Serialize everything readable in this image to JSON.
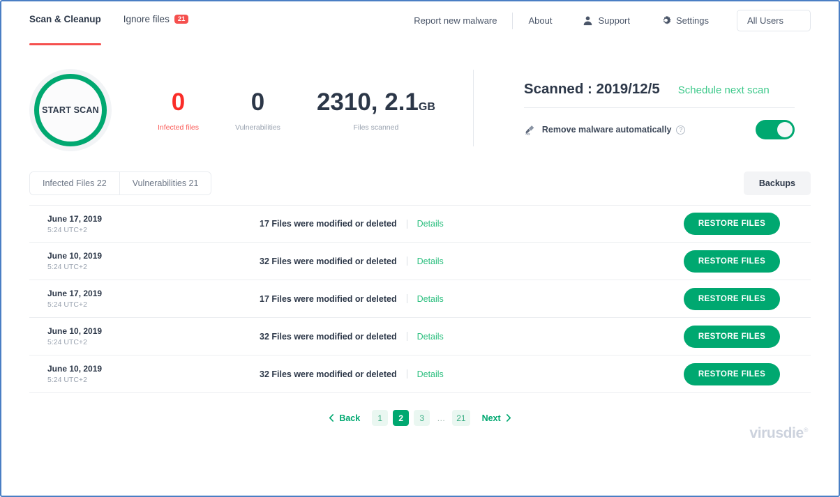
{
  "header": {
    "tabs": [
      {
        "label": "Scan & Cleanup",
        "active": true,
        "badge": null
      },
      {
        "label": "Ignore files",
        "active": false,
        "badge": "21"
      }
    ],
    "right_items": [
      {
        "label": "Report new malware",
        "icon": null
      },
      {
        "label": "About",
        "icon": null
      },
      {
        "label": "Support",
        "icon": "user-icon"
      },
      {
        "label": "Settings",
        "icon": "gear-icon"
      }
    ],
    "user_select": "All Users"
  },
  "scan": {
    "start_button": "START SCAN",
    "stats": [
      {
        "value": "0",
        "unit": "",
        "label": "Infected files",
        "color": "#fa2d28"
      },
      {
        "value": "0",
        "unit": "",
        "label": "Vulnerabilities",
        "color": "#2c3748"
      },
      {
        "value": "2310, 2.1",
        "unit": "GB",
        "label": "Files scanned",
        "color": "#2c3748"
      }
    ],
    "scanned_title": "Scanned : 2019/12/5",
    "schedule_link": "Schedule next scan",
    "remove_label": "Remove malware automatically",
    "help_glyph": "?",
    "toggle_on": true,
    "accent_green": "#00a870"
  },
  "tabbar": {
    "pills": [
      {
        "label": "Infected Files 22"
      },
      {
        "label": "Vulnerabilities 21"
      }
    ],
    "backups": "Backups"
  },
  "table": {
    "rows": [
      {
        "date": "June 17, 2019",
        "time": "5:24 UTC+2",
        "files": "17 Files were modified or deleted",
        "details": "Details",
        "action": "RESTORE FILES"
      },
      {
        "date": "June 10, 2019",
        "time": "5:24 UTC+2",
        "files": "32 Files were modified or deleted",
        "details": "Details",
        "action": "RESTORE FILES"
      },
      {
        "date": "June 17, 2019",
        "time": "5:24 UTC+2",
        "files": "17 Files were modified or deleted",
        "details": "Details",
        "action": "RESTORE FILES"
      },
      {
        "date": "June 10, 2019",
        "time": "5:24 UTC+2",
        "files": "32 Files were modified or deleted",
        "details": "Details",
        "action": "RESTORE FILES"
      },
      {
        "date": "June 10, 2019",
        "time": "5:24 UTC+2",
        "files": "32 Files were modified or deleted",
        "details": "Details",
        "action": "RESTORE FILES"
      }
    ]
  },
  "pagination": {
    "back": "Back",
    "next": "Next",
    "pages": [
      "1",
      "2",
      "3",
      "…",
      "21"
    ],
    "active_page": "2"
  },
  "brand": {
    "name": "virusdie",
    "mark": "®"
  }
}
